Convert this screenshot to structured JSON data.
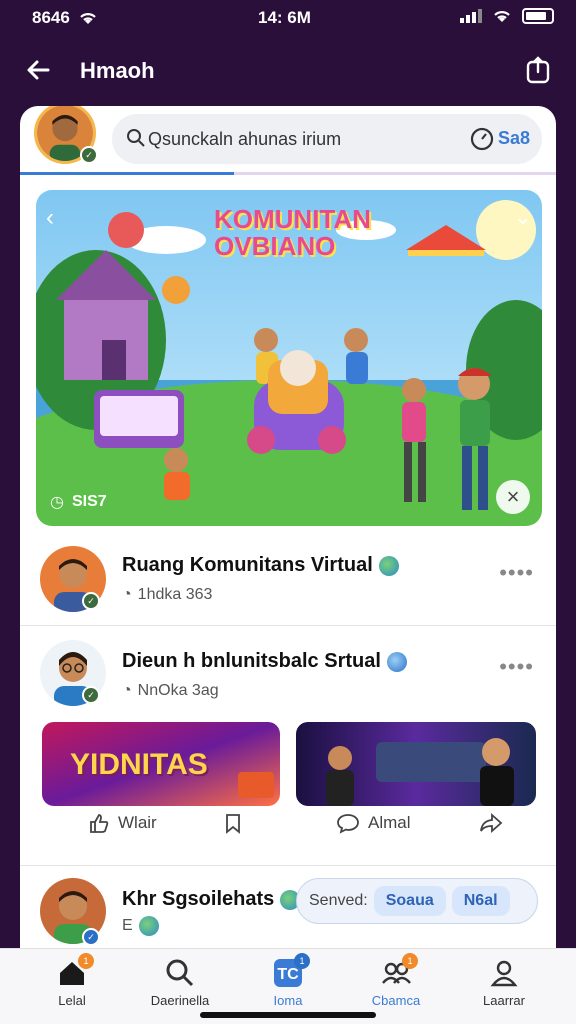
{
  "status_bar": {
    "time_left": "8646",
    "time_center": "14: 6M"
  },
  "header": {
    "title": "Hmaoh"
  },
  "search": {
    "placeholder": "Qsunckaln ahunas irium",
    "button": "Sa8"
  },
  "banner": {
    "title_line1": "KOMUNITAN",
    "title_line2": "OVBIANO",
    "counter": "SIS7"
  },
  "posts": [
    {
      "name": "Ruang Komunitans Virtual",
      "meta": "1hdka 363"
    },
    {
      "name": "Dieun h bnlunitsbalc Srtual",
      "meta": "NnOka 3ag"
    },
    {
      "name": "Khr Sgsoilehats",
      "meta": "E"
    }
  ],
  "thumbnails": [
    {
      "title": "YIDNITAS"
    },
    {
      "title": ""
    }
  ],
  "post_actions": {
    "like": "Wlair",
    "comment": "Almal"
  },
  "filter_toggle": {
    "label": "Senved:",
    "option1": "Soaua",
    "option2": "N6al"
  },
  "bottom_nav": [
    {
      "label": "Lelal",
      "icon": "home-icon",
      "badge": "1"
    },
    {
      "label": "Daerinella",
      "icon": "search-icon",
      "badge": ""
    },
    {
      "label": "Ioma",
      "icon": "tc-icon",
      "badge": "1"
    },
    {
      "label": "Cbamca",
      "icon": "people-icon",
      "badge": "1"
    },
    {
      "label": "Laarrar",
      "icon": "profile-icon",
      "badge": ""
    }
  ],
  "colors": {
    "background": "#2a0f3a",
    "accent": "#3a7bd5",
    "badge": "#f08a2b"
  }
}
